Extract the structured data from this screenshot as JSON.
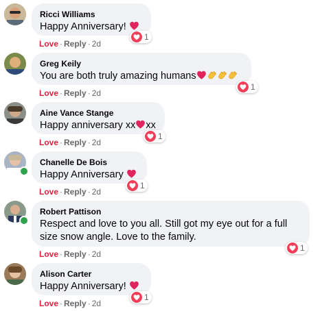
{
  "colors": {
    "bubble": "#f0f2f5",
    "love": "#e41e3f",
    "meta": "#65676b",
    "online": "#31a24c"
  },
  "icons": {
    "heart": "red-heart-emoji",
    "clap": "clapping-hands-emoji",
    "react_love": "love-reaction-icon"
  },
  "comments": [
    {
      "author": "Ricci Williams",
      "text": "Happy Anniversary! ",
      "love_label": "Love",
      "reply_label": "Reply",
      "time": "2d",
      "reaction_count": "1"
    },
    {
      "author": "Greg Keily",
      "text": "You are both truly amazing humans",
      "love_label": "Love",
      "reply_label": "Reply",
      "time": "2d",
      "reaction_count": "1"
    },
    {
      "author": "Aine Vance Stange",
      "text_a": "Happy anniversary xx",
      "text_b": "xx",
      "love_label": "Love",
      "reply_label": "Reply",
      "time": "2d",
      "reaction_count": "1"
    },
    {
      "author": "Chanelle De Bois",
      "text": "Happy Anniversary ",
      "love_label": "Love",
      "reply_label": "Reply",
      "time": "2d",
      "reaction_count": "1"
    },
    {
      "author": "Robert Pattison",
      "text": "Respect and love to you all. Still got my eye out for a full size snow angle. Love to the family.",
      "love_label": "Love",
      "reply_label": "Reply",
      "time": "2d",
      "reaction_count": "1"
    },
    {
      "author": "Alison Carter",
      "text": "Happy Anniversary! ",
      "love_label": "Love",
      "reply_label": "Reply",
      "time": "2d",
      "reaction_count": "1"
    }
  ]
}
